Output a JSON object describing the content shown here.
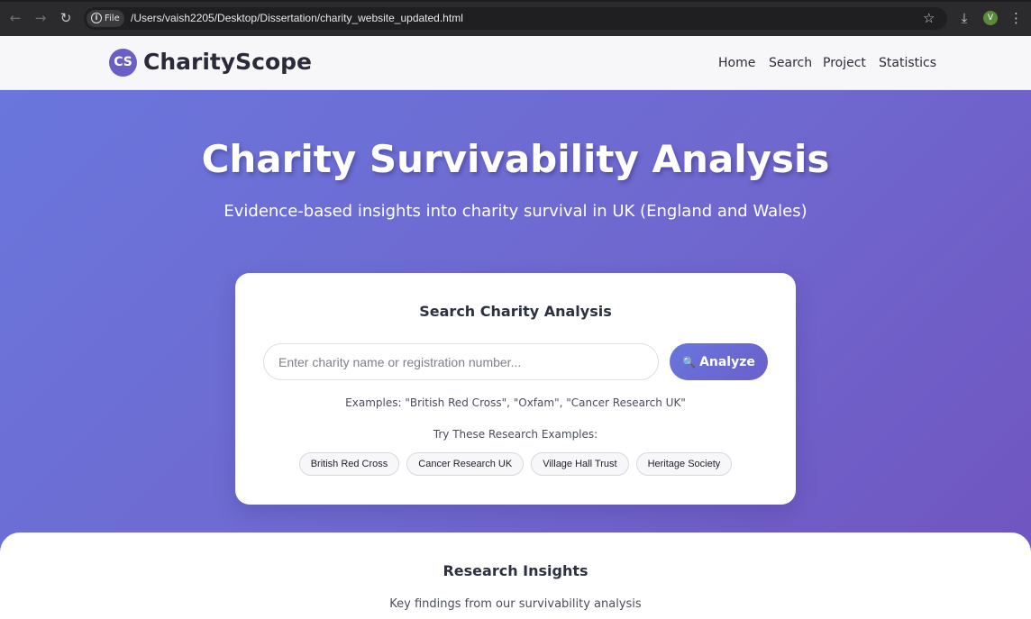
{
  "browser": {
    "file_label": "File",
    "url": "/Users/vaish2205/Desktop/Dissertation/charity_website_updated.html",
    "avatar_letter": "V",
    "icons": [
      "back-arrow-icon",
      "forward-arrow-icon",
      "reload-icon",
      "info-icon",
      "star-icon",
      "download-icon",
      "more-menu-icon"
    ]
  },
  "header": {
    "logo_text": "CS",
    "brand": "CharityScope",
    "nav": [
      "Home",
      "Search",
      "Project",
      "Statistics"
    ]
  },
  "hero": {
    "title": "Charity Survivability Analysis",
    "subtitle": "Evidence-based insights into charity survival in UK (England and Wales)"
  },
  "search_card": {
    "title": "Search Charity Analysis",
    "input_placeholder": "Enter charity name or registration number...",
    "input_value": "",
    "button_label": "Analyze",
    "button_icon": "magnifier-icon",
    "examples_text": "Examples: \"British Red Cross\", \"Oxfam\", \"Cancer Research UK\"",
    "try_label": "Try These Research Examples:",
    "chips": [
      "British Red Cross",
      "Cancer Research UK",
      "Village Hall Trust",
      "Heritage Society"
    ]
  },
  "insights": {
    "title": "Research Insights",
    "subtitle": "Key findings from our survivability analysis"
  },
  "colors": {
    "hero_gradient_start": "#6a76dc",
    "hero_gradient_end": "#7055c0",
    "logo_badge": "#6a5fc4",
    "chrome_bg": "#2b2b2d"
  }
}
